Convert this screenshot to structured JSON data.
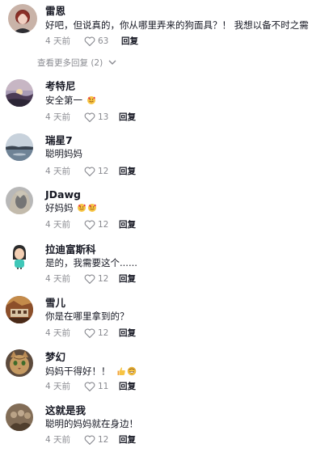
{
  "comments": [
    {
      "name": "雷恩",
      "text": "好吧，但说真的，你从哪里弄来的狗面具？！ 我想以备不时之需",
      "time": "4 天前",
      "likes": "63",
      "reply": "回复",
      "avatar": "woman-red-hair-avatar"
    },
    {
      "name": "考特尼",
      "text": "安全第一",
      "emoji": [
        "smiling-face-with-hearts-emoji"
      ],
      "time": "4 天前",
      "likes": "13",
      "reply": "回复",
      "avatar": "sunset-landscape-avatar"
    },
    {
      "name": "瑞星7",
      "text": "聪明妈妈",
      "time": "4 天前",
      "likes": "12",
      "reply": "回复",
      "avatar": "lake-sky-avatar"
    },
    {
      "name": "JDawg",
      "text": "好妈妈",
      "emoji": [
        "smiling-face-with-hearts-emoji",
        "smiling-face-with-hearts-emoji"
      ],
      "time": "4 天前",
      "likes": "12",
      "reply": "回复",
      "avatar": "blonde-portrait-avatar"
    },
    {
      "name": "拉迪富斯科",
      "text": "是的，我需要这个......",
      "time": "4 天前",
      "likes": "12",
      "reply": "回复",
      "avatar": "cartoon-girl-avatar"
    },
    {
      "name": "雪儿",
      "text": "你是在哪里拿到的？",
      "time": "4 天前",
      "likes": "12",
      "reply": "回复",
      "avatar": "autumn-house-avatar"
    },
    {
      "name": "梦幻",
      "text": "妈妈干得好！！",
      "emoji": [
        "thumbs-up-emoji",
        "grinning-face-emoji"
      ],
      "time": "4 天前",
      "likes": "11",
      "reply": "回复",
      "avatar": "cat-avatar"
    },
    {
      "name": "这就是我",
      "text": "聪明的妈妈就在身边！",
      "time": "4 天前",
      "likes": "12",
      "reply": "回复",
      "avatar": "sepia-group-avatar"
    }
  ],
  "more_replies": {
    "label": "查看更多回复 (2)"
  }
}
